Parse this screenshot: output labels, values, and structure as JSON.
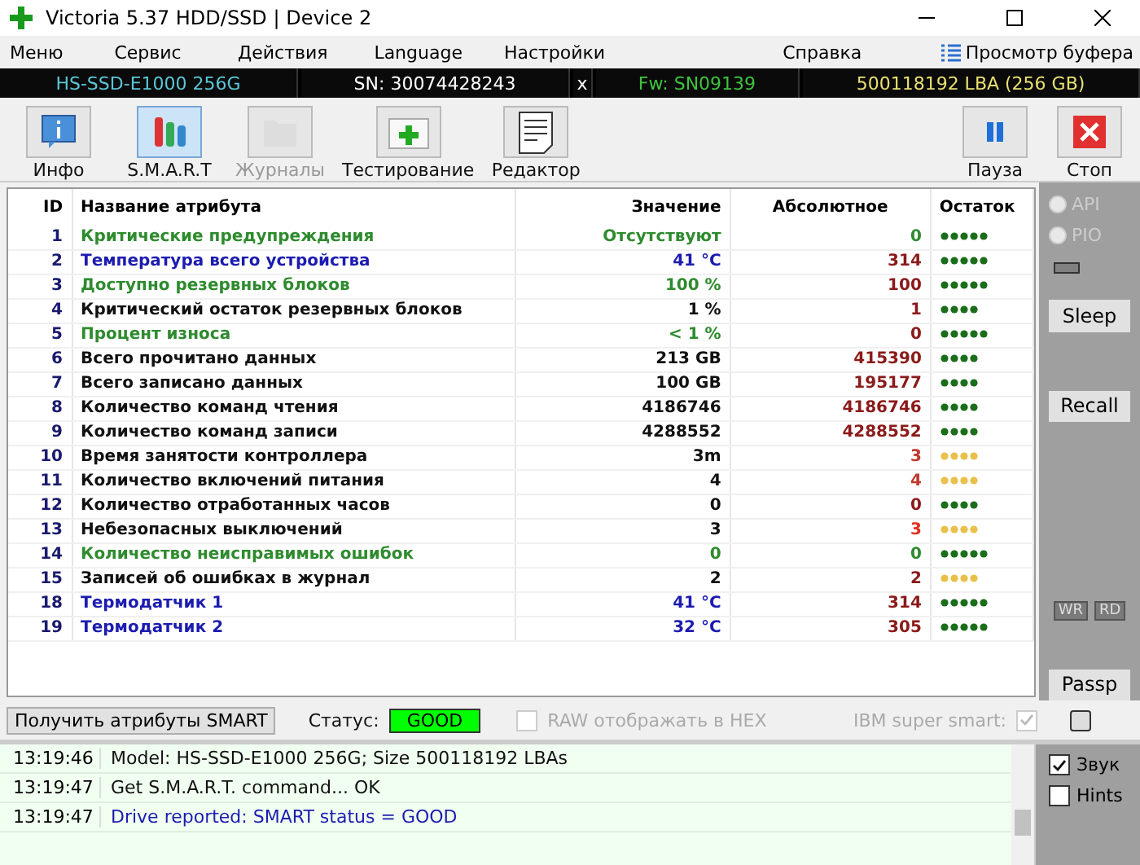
{
  "window": {
    "title": "Victoria 5.37 HDD/SSD | Device 2"
  },
  "menu": [
    "Меню",
    "Сервис",
    "Действия",
    "Language",
    "Настройки",
    "Справка"
  ],
  "buffer_view": "Просмотр буфера",
  "device_bar": {
    "model": "HS-SSD-E1000 256G",
    "serial": "SN: 30074428243",
    "close": "x",
    "firmware": "Fw: SN09139",
    "capacity": "500118192 LBA (256 GB)"
  },
  "toolbar": [
    {
      "kind": "info",
      "label": "Инфо",
      "selected": false,
      "disabled": false
    },
    {
      "kind": "smart",
      "label": "S.M.A.R.T",
      "selected": true,
      "disabled": false
    },
    {
      "kind": "logs",
      "label": "Журналы",
      "selected": false,
      "disabled": true
    },
    {
      "kind": "test",
      "label": "Тестирование",
      "selected": false,
      "disabled": false
    },
    {
      "kind": "editor",
      "label": "Редактор",
      "selected": false,
      "disabled": false
    }
  ],
  "toolbar_right": [
    {
      "kind": "pause",
      "label": "Пауза"
    },
    {
      "kind": "stop",
      "label": "Стоп"
    }
  ],
  "table": {
    "columns": [
      "ID",
      "Название атрибута",
      "Значение",
      "Абсолютное",
      "Остаток"
    ],
    "rows": [
      {
        "id": "1",
        "name": "Критические предупреждения",
        "value": "Отсутствуют",
        "color": "#2e8b2e",
        "raw": {
          "text": "0",
          "color": "#2e8b2e"
        },
        "health": {
          "stars": 5,
          "color": "#1a6e1a"
        }
      },
      {
        "id": "2",
        "name": "Температура всего устройства",
        "value": "41 °C",
        "color": "#1c1cb0",
        "raw": {
          "text": "314",
          "color": "#8b1a1a"
        },
        "health": {
          "stars": 5,
          "color": "#1a6e1a"
        }
      },
      {
        "id": "3",
        "name": "Доступно резервных блоков",
        "value": "100 %",
        "color": "#2e8b2e",
        "raw": {
          "text": "100",
          "color": "#8b1a1a"
        },
        "health": {
          "stars": 5,
          "color": "#1a6e1a"
        }
      },
      {
        "id": "4",
        "name": "Критический остаток резервных блоков",
        "value": "1 %",
        "color": "#111111",
        "raw": {
          "text": "1",
          "color": "#8b1a1a"
        },
        "health": {
          "stars": 4,
          "color": "#1a6e1a"
        }
      },
      {
        "id": "5",
        "name": "Процент износа",
        "value": "< 1 %",
        "color": "#2e8b2e",
        "raw": {
          "text": "0",
          "color": "#8b1a1a"
        },
        "health": {
          "stars": 5,
          "color": "#1a6e1a"
        }
      },
      {
        "id": "6",
        "name": "Всего прочитано данных",
        "value": "213 GB",
        "color": "#111111",
        "raw": {
          "text": "415390",
          "color": "#8b1a1a"
        },
        "health": {
          "stars": 4,
          "color": "#1a6e1a"
        }
      },
      {
        "id": "7",
        "name": "Всего записано данных",
        "value": "100 GB",
        "color": "#111111",
        "raw": {
          "text": "195177",
          "color": "#8b1a1a"
        },
        "health": {
          "stars": 4,
          "color": "#1a6e1a"
        }
      },
      {
        "id": "8",
        "name": "Количество команд чтения",
        "value": "4186746",
        "color": "#111111",
        "raw": {
          "text": "4186746",
          "color": "#8b1a1a"
        },
        "health": {
          "stars": 4,
          "color": "#1a6e1a"
        }
      },
      {
        "id": "9",
        "name": "Количество команд записи",
        "value": "4288552",
        "color": "#111111",
        "raw": {
          "text": "4288552",
          "color": "#8b1a1a"
        },
        "health": {
          "stars": 4,
          "color": "#1a6e1a"
        }
      },
      {
        "id": "10",
        "name": "Время занятости контроллера",
        "value": "3m",
        "color": "#111111",
        "raw": {
          "text": "3",
          "color": "#c0392b"
        },
        "health": {
          "stars": 4,
          "color": "#e8c04a"
        }
      },
      {
        "id": "11",
        "name": "Количество включений питания",
        "value": "4",
        "color": "#111111",
        "raw": {
          "text": "4",
          "color": "#c0392b"
        },
        "health": {
          "stars": 4,
          "color": "#e8c04a"
        }
      },
      {
        "id": "12",
        "name": "Количество отработанных часов",
        "value": "0",
        "color": "#111111",
        "raw": {
          "text": "0",
          "color": "#8b1a1a"
        },
        "health": {
          "stars": 4,
          "color": "#1a6e1a"
        }
      },
      {
        "id": "13",
        "name": "Небезопасных выключений",
        "value": "3",
        "color": "#111111",
        "raw": {
          "text": "3",
          "color": "#e03020"
        },
        "health": {
          "stars": 4,
          "color": "#e8c04a"
        }
      },
      {
        "id": "14",
        "name": "Количество неисправимых ошибок",
        "value": "0",
        "color": "#2e8b2e",
        "raw": {
          "text": "0",
          "color": "#2e8b2e"
        },
        "health": {
          "stars": 5,
          "color": "#1a6e1a"
        }
      },
      {
        "id": "15",
        "name": "Записей об ошибках в журнал",
        "value": "2",
        "color": "#111111",
        "raw": {
          "text": "2",
          "color": "#8b1a1a"
        },
        "health": {
          "stars": 4,
          "color": "#e8c04a"
        }
      },
      {
        "id": "18",
        "name": "Термодатчик 1",
        "value": "41 °C",
        "color": "#1c1cb0",
        "raw": {
          "text": "314",
          "color": "#8b1a1a"
        },
        "health": {
          "stars": 5,
          "color": "#1a6e1a"
        }
      },
      {
        "id": "19",
        "name": "Термодатчик 2",
        "value": "32 °C",
        "color": "#1c1cb0",
        "raw": {
          "text": "305",
          "color": "#8b1a1a"
        },
        "health": {
          "stars": 5,
          "color": "#1a6e1a"
        }
      }
    ]
  },
  "side_panel": {
    "radios": [
      {
        "label": "API",
        "selected": false
      },
      {
        "label": "PIO",
        "selected": false
      }
    ],
    "buttons": [
      "Sleep",
      "Recall"
    ],
    "indicators": [
      "WR",
      "RD"
    ],
    "bottom_button": "Passp"
  },
  "bottom_bar": {
    "button": "Получить атрибуты SMART",
    "status_label": "Статус:",
    "status": "GOOD",
    "raw_hex": {
      "label": "RAW отображать в HEX",
      "checked": false
    },
    "ibm": {
      "label": "IBM super smart:",
      "checked": true
    },
    "extra_checked": false
  },
  "log": [
    {
      "time": "13:19:46",
      "message": "Model: HS-SSD-E1000 256G; Size 500118192 LBAs",
      "kind": "normal"
    },
    {
      "time": "13:19:47",
      "message": "Get S.M.A.R.T. command... OK",
      "kind": "normal"
    },
    {
      "time": "13:19:47",
      "message": "Drive reported: SMART status = GOOD",
      "kind": "success"
    }
  ],
  "log_options": [
    {
      "label": "Звук",
      "checked": true
    },
    {
      "label": "Hints",
      "checked": false
    }
  ]
}
